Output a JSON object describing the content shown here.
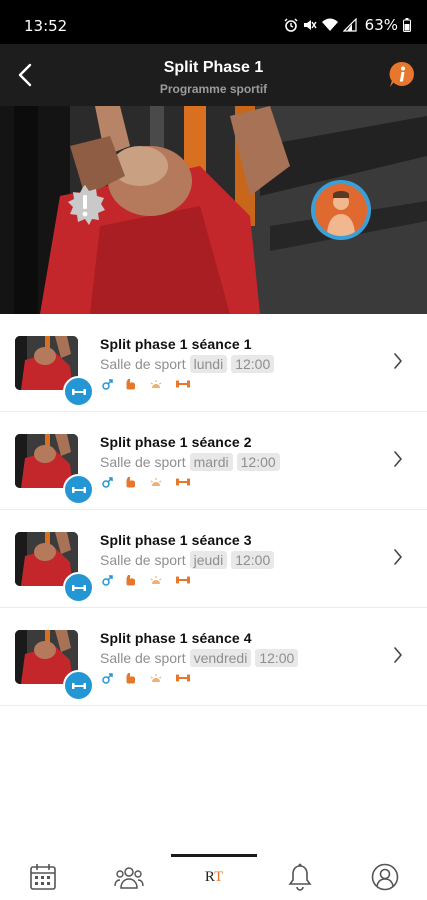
{
  "status_bar": {
    "time": "13:52",
    "battery": "63%"
  },
  "header": {
    "title": "Split Phase 1",
    "subtitle": "Programme sportif"
  },
  "sessions": [
    {
      "title": "Split phase 1 séance 1",
      "location": "Salle de sport",
      "day": "lundi",
      "time": "12:00"
    },
    {
      "title": "Split phase 1 séance 2",
      "location": "Salle de sport",
      "day": "mardi",
      "time": "12:00"
    },
    {
      "title": "Split phase 1 séance 3",
      "location": "Salle de sport",
      "day": "jeudi",
      "time": "12:00"
    },
    {
      "title": "Split phase 1 séance 4",
      "location": "Salle de sport",
      "day": "vendredi",
      "time": "12:00"
    }
  ],
  "nav": {
    "rt_label_r": "R",
    "rt_label_t": "T"
  },
  "colors": {
    "accent_orange": "#e8772e",
    "accent_blue": "#2596d4",
    "header_bg": "#1d1d1d"
  },
  "icons": [
    "back-arrow-icon",
    "info-icon",
    "alert-badge-icon",
    "dumbbell-icon",
    "male-icon",
    "bicep-icon",
    "sun-icon",
    "calendar-icon",
    "community-icon",
    "bell-icon",
    "profile-icon",
    "chevron-right-icon"
  ]
}
